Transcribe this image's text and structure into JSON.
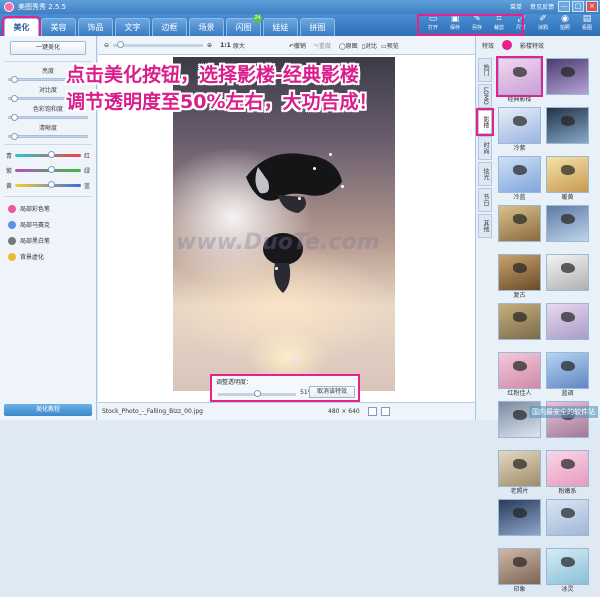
{
  "window": {
    "title": "美图秀秀 2.5.5",
    "links": [
      "菜单",
      "意见反馈"
    ],
    "controls": [
      "—",
      "□",
      "×"
    ]
  },
  "tabs": [
    {
      "label": "美化",
      "active": true
    },
    {
      "label": "美容",
      "active": false
    },
    {
      "label": "饰品",
      "active": false
    },
    {
      "label": "文字",
      "active": false
    },
    {
      "label": "边框",
      "active": false
    },
    {
      "label": "场景",
      "active": false
    },
    {
      "label": "闪图",
      "active": false,
      "badge": "24"
    },
    {
      "label": "娃娃",
      "active": false
    },
    {
      "label": "拼图",
      "active": false
    }
  ],
  "toolbar_right": [
    {
      "label": "打开",
      "icon": "open-icon"
    },
    {
      "label": "保存",
      "icon": "save-icon"
    },
    {
      "label": "另存",
      "icon": "save-as-icon"
    },
    {
      "label": "裁剪",
      "icon": "crop-icon"
    },
    {
      "label": "尺寸",
      "icon": "resize-icon"
    },
    {
      "label": "涂鸦",
      "icon": "brush-icon"
    },
    {
      "label": "拍照",
      "icon": "camera-icon"
    },
    {
      "label": "看图",
      "icon": "view-icon"
    }
  ],
  "left_panel": {
    "one_key": "一键美化",
    "brightness": "亮度",
    "contrast": "对比度",
    "saturation": "色彩饱和度",
    "clarity": "清晰度",
    "color_rows": [
      {
        "left": "青",
        "right": "红",
        "gradient": "linear-gradient(90deg,#22cccc,#ff3b3b)"
      },
      {
        "left": "紫",
        "right": "绿",
        "gradient": "linear-gradient(90deg,#b84ec9,#3bbf3b)"
      },
      {
        "left": "黄",
        "right": "蓝",
        "gradient": "linear-gradient(90deg,#f2d230,#3a6ee0)"
      }
    ],
    "tools": [
      {
        "label": "局部彩色笔",
        "color": "#e85b9a"
      },
      {
        "label": "局部马赛克",
        "color": "#5b8fe8"
      },
      {
        "label": "局部黑白笔",
        "color": "#777777"
      },
      {
        "label": "背景虚化",
        "color": "#f2b630"
      }
    ],
    "tutorial": "美化教程"
  },
  "center_toolbar": {
    "zoom_label": "1:1",
    "original_size": "原大",
    "undo": "撤销",
    "redo": "重做",
    "original": "原图",
    "compare": "对比",
    "preview": "预览"
  },
  "promo": {
    "line1": "点击美化按钮，选择影楼-经典影楼",
    "line2": "调节透明度至50%左右，大功告成！"
  },
  "watermark": "www.DuoTe.com",
  "transparency": {
    "label": "调整透明度：",
    "value": "51%",
    "level": 0.51,
    "cancel": "取消该特效"
  },
  "status": {
    "filename": "Stock_Photo_-_Falling_Bizz_00.jpg",
    "dimensions": "480 × 640"
  },
  "right_panel": {
    "header_left": "特效",
    "header_right": "影楼特效",
    "side_tabs": [
      "热门",
      "LOMO",
      "影楼",
      "时尚",
      "炫光",
      "节日",
      "其他"
    ],
    "effects": [
      {
        "label": "经典影楼",
        "selected": true,
        "colors": [
          "#f3d6f0",
          "#c9a0d9"
        ]
      },
      {
        "label": "",
        "selected": false,
        "colors": [
          "#4b3b6e",
          "#b7a3d8"
        ]
      },
      {
        "label": "冷紫",
        "selected": false,
        "colors": [
          "#e7eef8",
          "#9bb4e0"
        ]
      },
      {
        "label": "",
        "selected": false,
        "colors": [
          "#223344",
          "#88aacc"
        ]
      },
      {
        "label": "冷蓝",
        "selected": false,
        "colors": [
          "#cfe0f7",
          "#7fa6dc"
        ]
      },
      {
        "label": "暖黄",
        "selected": false,
        "colors": [
          "#f6e2a8",
          "#c79a52"
        ]
      },
      {
        "label": "",
        "selected": false,
        "colors": [
          "#d8c28a",
          "#8a6a40"
        ]
      },
      {
        "label": "",
        "selected": false,
        "colors": [
          "#5d7aa6",
          "#c0d4ea"
        ]
      },
      {
        "label": "复古",
        "selected": false,
        "colors": [
          "#c8a36a",
          "#6b4a2a"
        ]
      },
      {
        "label": "",
        "selected": false,
        "colors": [
          "#f4f4f4",
          "#b0b0b0"
        ]
      },
      {
        "label": "",
        "selected": false,
        "colors": [
          "#c7b07d",
          "#7b6a4a"
        ]
      },
      {
        "label": "",
        "selected": false,
        "colors": [
          "#e9d8f0",
          "#a99cc8"
        ]
      },
      {
        "label": "红粉佳人",
        "selected": false,
        "colors": [
          "#f3c9d9",
          "#d08aa8"
        ]
      },
      {
        "label": "蓝调",
        "selected": false,
        "colors": [
          "#b8d3f0",
          "#5e87c4"
        ]
      },
      {
        "label": "",
        "selected": false,
        "colors": [
          "#7a8aa0",
          "#dfe6ee"
        ]
      },
      {
        "label": "",
        "selected": false,
        "colors": [
          "#eac4d6",
          "#a07898"
        ]
      },
      {
        "label": "老照片",
        "selected": false,
        "colors": [
          "#e4d8c2",
          "#a08c6a"
        ]
      },
      {
        "label": "粉嫩系",
        "selected": false,
        "colors": [
          "#f9d7e6",
          "#e69bbf"
        ]
      },
      {
        "label": "",
        "selected": false,
        "colors": [
          "#2a3a5a",
          "#8fa8cc"
        ]
      },
      {
        "label": "",
        "selected": false,
        "colors": [
          "#d9e6f3",
          "#9fb8d6"
        ]
      },
      {
        "label": "印象",
        "selected": false,
        "colors": [
          "#cfb8a6",
          "#7d6556"
        ]
      },
      {
        "label": "冰灵",
        "selected": false,
        "colors": [
          "#d4ecf5",
          "#8ac0d8"
        ]
      }
    ],
    "bottom_logo": "国内最安全的软件站"
  }
}
